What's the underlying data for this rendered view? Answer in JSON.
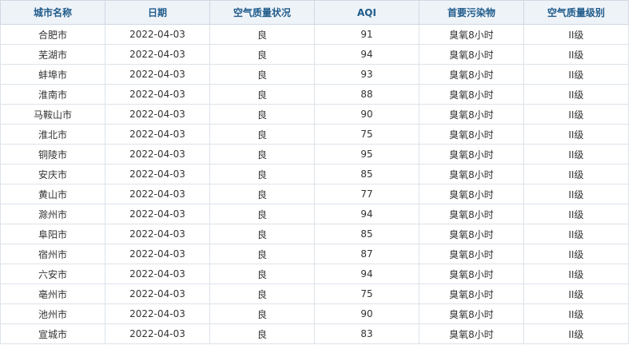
{
  "table": {
    "headers": [
      "城市名称",
      "日期",
      "空气质量状况",
      "AQI",
      "首要污染物",
      "空气质量级别"
    ],
    "rows": [
      [
        "合肥市",
        "2022-04-03",
        "良",
        "91",
        "臭氧8小时",
        "II级"
      ],
      [
        "芜湖市",
        "2022-04-03",
        "良",
        "94",
        "臭氧8小时",
        "II级"
      ],
      [
        "蚌埠市",
        "2022-04-03",
        "良",
        "93",
        "臭氧8小时",
        "II级"
      ],
      [
        "淮南市",
        "2022-04-03",
        "良",
        "88",
        "臭氧8小时",
        "II级"
      ],
      [
        "马鞍山市",
        "2022-04-03",
        "良",
        "90",
        "臭氧8小时",
        "II级"
      ],
      [
        "淮北市",
        "2022-04-03",
        "良",
        "75",
        "臭氧8小时",
        "II级"
      ],
      [
        "铜陵市",
        "2022-04-03",
        "良",
        "95",
        "臭氧8小时",
        "II级"
      ],
      [
        "安庆市",
        "2022-04-03",
        "良",
        "85",
        "臭氧8小时",
        "II级"
      ],
      [
        "黄山市",
        "2022-04-03",
        "良",
        "77",
        "臭氧8小时",
        "II级"
      ],
      [
        "滁州市",
        "2022-04-03",
        "良",
        "94",
        "臭氧8小时",
        "II级"
      ],
      [
        "阜阳市",
        "2022-04-03",
        "良",
        "85",
        "臭氧8小时",
        "II级"
      ],
      [
        "宿州市",
        "2022-04-03",
        "良",
        "87",
        "臭氧8小时",
        "II级"
      ],
      [
        "六安市",
        "2022-04-03",
        "良",
        "94",
        "臭氧8小时",
        "II级"
      ],
      [
        "亳州市",
        "2022-04-03",
        "良",
        "75",
        "臭氧8小时",
        "II级"
      ],
      [
        "池州市",
        "2022-04-03",
        "良",
        "90",
        "臭氧8小时",
        "II级"
      ],
      [
        "宣城市",
        "2022-04-03",
        "良",
        "83",
        "臭氧8小时",
        "II级"
      ]
    ]
  },
  "colors": {
    "header_bg": "#eef3f8",
    "header_text": "#1f5b8a",
    "cell_text": "#333333",
    "border": "#dde3ea"
  }
}
